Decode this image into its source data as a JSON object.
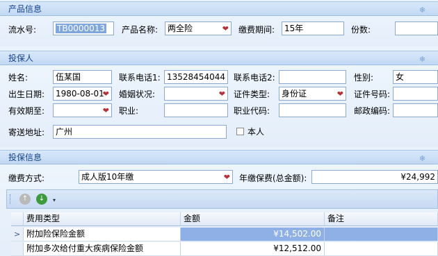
{
  "product_info": {
    "title": "产品信息",
    "serial_label": "流水号:",
    "serial_value": "TB0000013",
    "product_name_label": "产品名称:",
    "product_name_value": "两全险",
    "payment_period_label": "缴费期间:",
    "payment_period_value": "15年",
    "copies_label": "份数:",
    "copies_value": ""
  },
  "insured": {
    "title": "投保人",
    "name_label": "姓名:",
    "name_value": "伍某国",
    "phone1_label": "联系电话1:",
    "phone1_value": "13528454044",
    "phone2_label": "联系电话2:",
    "phone2_value": "",
    "gender_label": "性别:",
    "gender_value": "女",
    "birth_label": "出生日期:",
    "birth_value": "1980-08-01",
    "marital_label": "婚姻状况:",
    "marital_value": "",
    "id_type_label": "证件类型:",
    "id_type_value": "身份证",
    "id_no_label": "证件号码:",
    "id_no_value": "",
    "valid_until_label": "有效期至:",
    "valid_until_value": "",
    "job_label": "职业:",
    "job_value": "",
    "job_code_label": "职业代码:",
    "job_code_value": "",
    "postcode_label": "邮政编码:",
    "postcode_value": "",
    "address_label": "寄送地址:",
    "address_value": "广州",
    "self_label": "本人"
  },
  "policy_info": {
    "title": "投保信息",
    "pay_method_label": "缴费方式:",
    "pay_method_value": "成人版10年缴",
    "annual_premium_label": "年缴保费(总金额):",
    "annual_premium_value": "¥24,992"
  },
  "grid": {
    "headers": [
      "费用类型",
      "金额",
      "备注"
    ],
    "rows": [
      {
        "type": "附加险保险金额",
        "amount": "¥14,502.00",
        "note": ""
      },
      {
        "type": "附加多次给付重大疾病保险金额",
        "amount": "¥12,512.00",
        "note": ""
      }
    ]
  },
  "icons": {
    "section": "snowflake-icon",
    "dropdown": "heart-dropdown-icon"
  },
  "colors": {
    "header_text": "#15428b",
    "selected_row": "#8fb0e6",
    "dropdown_heart": "#b5323a"
  }
}
